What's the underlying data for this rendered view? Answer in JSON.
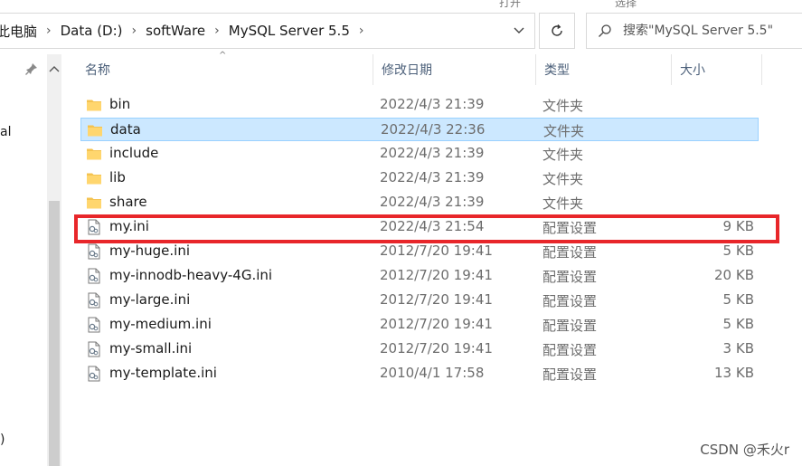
{
  "ribbon": {
    "fragments": [
      "打开",
      "选择"
    ]
  },
  "address": {
    "crumbs": [
      "此电脑",
      "Data (D:)",
      "softWare",
      "MySQL Server 5.5"
    ]
  },
  "search": {
    "placeholder": "搜索\"MySQL Server 5.5\""
  },
  "nav": {
    "fragment_1": "al",
    "fragment_2": ")"
  },
  "columns": {
    "name": "名称",
    "date": "修改日期",
    "type": "类型",
    "size": "大小"
  },
  "files": [
    {
      "name": "bin",
      "date": "2022/4/3 21:39",
      "type": "文件夹",
      "size": "",
      "kind": "folder"
    },
    {
      "name": "data",
      "date": "2022/4/3 22:36",
      "type": "文件夹",
      "size": "",
      "kind": "folder"
    },
    {
      "name": "include",
      "date": "2022/4/3 21:39",
      "type": "文件夹",
      "size": "",
      "kind": "folder"
    },
    {
      "name": "lib",
      "date": "2022/4/3 21:39",
      "type": "文件夹",
      "size": "",
      "kind": "folder"
    },
    {
      "name": "share",
      "date": "2022/4/3 21:39",
      "type": "文件夹",
      "size": "",
      "kind": "folder"
    },
    {
      "name": "my.ini",
      "date": "2022/4/3 21:54",
      "type": "配置设置",
      "size": "9 KB",
      "kind": "ini"
    },
    {
      "name": "my-huge.ini",
      "date": "2012/7/20 19:41",
      "type": "配置设置",
      "size": "5 KB",
      "kind": "ini"
    },
    {
      "name": "my-innodb-heavy-4G.ini",
      "date": "2012/7/20 19:41",
      "type": "配置设置",
      "size": "20 KB",
      "kind": "ini"
    },
    {
      "name": "my-large.ini",
      "date": "2012/7/20 19:41",
      "type": "配置设置",
      "size": "5 KB",
      "kind": "ini"
    },
    {
      "name": "my-medium.ini",
      "date": "2012/7/20 19:41",
      "type": "配置设置",
      "size": "5 KB",
      "kind": "ini"
    },
    {
      "name": "my-small.ini",
      "date": "2012/7/20 19:41",
      "type": "配置设置",
      "size": "3 KB",
      "kind": "ini"
    },
    {
      "name": "my-template.ini",
      "date": "2010/4/1 17:58",
      "type": "配置设置",
      "size": "13 KB",
      "kind": "ini"
    }
  ],
  "selected_file": "data",
  "highlighted_file": "my.ini",
  "watermark": "CSDN @禾火r",
  "colors": {
    "folder": "#f4c351",
    "selection": "#cce8ff",
    "highlight_border": "#e8262a"
  }
}
